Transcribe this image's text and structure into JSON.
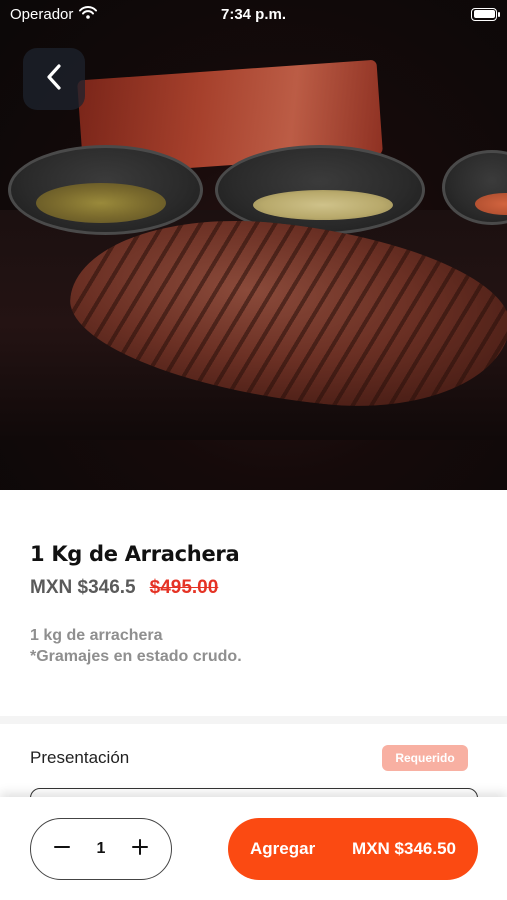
{
  "status_bar": {
    "carrier": "Operador",
    "time": "7:34 p.m.",
    "icons": [
      "wifi-icon",
      "battery-icon"
    ]
  },
  "navigation": {
    "back_icon": "chevron-left-icon"
  },
  "product": {
    "image": "grilled-arrachera-steak-photo",
    "title": "1 Kg de Arrachera",
    "price": "MXN $346.5",
    "original_price": "$495.00",
    "description_lines": [
      "1 kg de arrachera",
      "*Gramajes en estado crudo."
    ]
  },
  "options": {
    "section_label": "Presentación",
    "required_badge": "Requerido"
  },
  "cart": {
    "quantity": "1",
    "decrement_icon": "minus-icon",
    "increment_icon": "plus-icon",
    "add_label": "Agregar",
    "add_total": "MXN $346.50"
  },
  "colors": {
    "accent": "#fb4a12",
    "strike_price": "#e53325",
    "badge_bg": "#f8b0a2",
    "muted_text": "#8f8f8f"
  }
}
